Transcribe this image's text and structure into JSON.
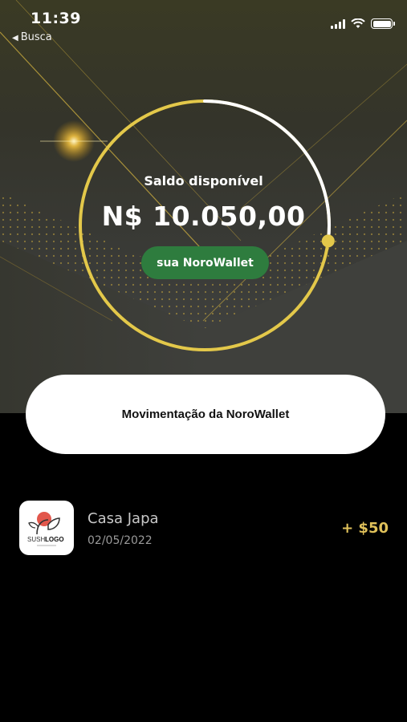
{
  "status_bar": {
    "time": "11:39",
    "back_label": "Busca"
  },
  "balance": {
    "label": "Saldo disponível",
    "amount": "N$ 10.050,00",
    "wallet_button": "sua NoroWallet",
    "ring_progress": 0.27
  },
  "movements": {
    "title": "Movimentação da NoroWallet"
  },
  "transactions": [
    {
      "name": "Casa Japa",
      "date": "02/05/2022",
      "amount": "+ $50",
      "logo": {
        "brand": "SUSHI LOGO",
        "text_a": "SUSHI",
        "text_b": "LOGO",
        "icon": "sushi-logo-icon"
      }
    }
  ],
  "colors": {
    "accent_gold": "#e0c15a",
    "button_green": "#2e7c3e",
    "ring_gold": "#e3c84a"
  }
}
